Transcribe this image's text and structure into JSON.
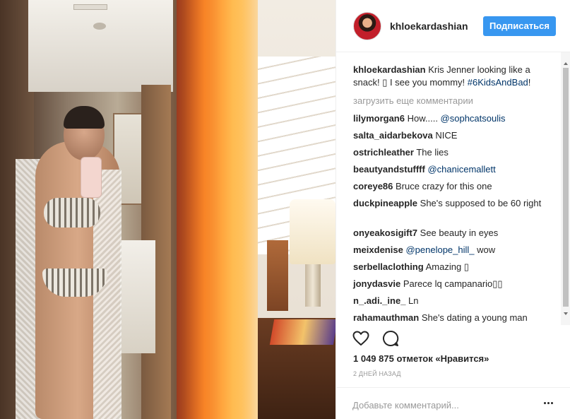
{
  "post": {
    "username": "khloekardashian",
    "follow_label": "Подписаться"
  },
  "caption": {
    "username": "khloekardashian",
    "text_before": " Kris Jenner looking like a snack! ",
    "emoji": "▯",
    "text_after": " I see you mommy! ",
    "hashtag": "#6KidsAndBad",
    "suffix": "!"
  },
  "load_more": "загрузить еще комментарии",
  "comments": [
    {
      "username": "lilymorgan6",
      "text": " How..... ",
      "mention": "@sophcatsoulis"
    },
    {
      "username": "salta_aidarbekova",
      "text": " NICE",
      "mention": ""
    },
    {
      "username": "ostrichleather",
      "text": " The lies",
      "mention": ""
    },
    {
      "username": "beautyandstuffff",
      "text": " ",
      "mention": "@chanicemallett"
    },
    {
      "username": "coreye86",
      "text": " Bruce crazy for this one",
      "mention": ""
    },
    {
      "username": "duckpineapple",
      "text": " She's supposed to be 60 right",
      "mention": ""
    },
    {
      "username": "onyeakosigift7",
      "text": " See beauty in eyes",
      "mention": ""
    },
    {
      "username": "meixdenise",
      "text": " ",
      "mention": "@penelope_hill_",
      "after": " wow"
    },
    {
      "username": "serbellaclothing",
      "text": " Amazing ▯",
      "mention": ""
    },
    {
      "username": "jonydasvie",
      "text": " Parece lq campanario▯▯",
      "mention": ""
    },
    {
      "username": "n_.adi._ine_",
      "text": " Ln",
      "mention": ""
    },
    {
      "username": "rahamauthman",
      "text": " She's dating a young man",
      "mention": ""
    }
  ],
  "likes_text": "1 049 875 отметок «Нравится»",
  "time_text": "2 ДНЕЙ НАЗАД",
  "add_comment_placeholder": "Добавьте комментарий...",
  "icons": {
    "like": "heart-icon",
    "comment": "comment-bubble-icon",
    "more": "more-options-icon"
  },
  "colors": {
    "accent": "#3897f0",
    "mention": "#003569",
    "muted": "#999999",
    "text": "#262626"
  }
}
